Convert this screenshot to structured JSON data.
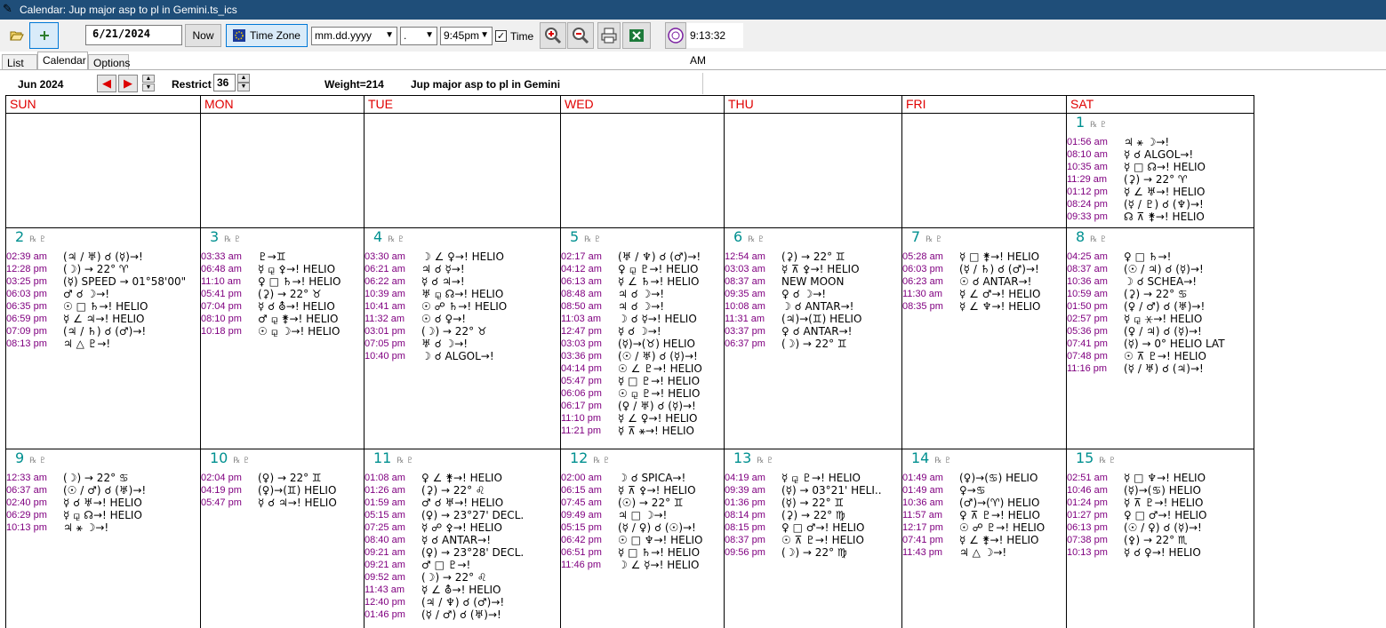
{
  "window": {
    "title": "Calendar: Jup major asp to pl in Gemini.ts_ics"
  },
  "toolbar": {
    "open_icon": "folder-open-icon",
    "add_icon": "plus-icon",
    "date_value": "6/21/2024",
    "now_label": "Now",
    "timezone_label": "Time Zone",
    "date_format_value": "mm.dd.yyyy",
    "separator_value": ".",
    "time_value": "9:45pm",
    "time_checked": true,
    "time_label": "Time",
    "clock_text": "9:13:32 AM"
  },
  "tabs": [
    "List",
    "Calendar",
    "Options"
  ],
  "nav": {
    "month_label": "Jun  2024",
    "restrict_label": "Restrict",
    "restrict_value": "36",
    "weight_text": "Weight=214",
    "search_name": "Jup major asp to pl in Gemini"
  },
  "calendar": {
    "day_names": [
      "SUN",
      "MON",
      "TUE",
      "WED",
      "THU",
      "FRI",
      "SAT"
    ],
    "weeks": [
      [
        {
          "date": "",
          "events": []
        },
        {
          "date": "",
          "events": []
        },
        {
          "date": "",
          "events": []
        },
        {
          "date": "",
          "events": []
        },
        {
          "date": "",
          "events": []
        },
        {
          "date": "",
          "events": []
        },
        {
          "date": "1",
          "events": [
            {
              "time": "01:56 am",
              "desc": "♃ ⚹ ☽→!"
            },
            {
              "time": "08:10 am",
              "desc": "☿ ☌ ALGOL→!"
            },
            {
              "time": "10:35 am",
              "desc": "☿ □ ☊→! HELIO"
            },
            {
              "time": "11:29 am",
              "desc": "(⚳) → 22° ♈"
            },
            {
              "time": "01:12 pm",
              "desc": "☿ ∠ ♅→! HELIO"
            },
            {
              "time": "08:24 pm",
              "desc": "(☿ / ♇) ☌ (♆)→!"
            },
            {
              "time": "09:33 pm",
              "desc": "☊ ⊼ ⚵→! HELIO"
            }
          ]
        }
      ],
      [
        {
          "date": "2",
          "events": [
            {
              "time": "02:39 am",
              "desc": "(♃ / ♅) ☌ (☿)→!"
            },
            {
              "time": "12:28 pm",
              "desc": "(☽) → 22° ♈"
            },
            {
              "time": "03:25 pm",
              "desc": "(☿) SPEED → 01°58'00\""
            },
            {
              "time": "06:03 pm",
              "desc": "♂ ☌ ☽→!"
            },
            {
              "time": "06:35 pm",
              "desc": "☉ □ ♄→! HELIO"
            },
            {
              "time": "06:59 pm",
              "desc": "☿ ∠ ♃→! HELIO"
            },
            {
              "time": "07:09 pm",
              "desc": "(♃ / ♄) ☌ (♂)→!"
            },
            {
              "time": "08:13 pm",
              "desc": "♃ △ ♇→!"
            }
          ]
        },
        {
          "date": "3",
          "events": [
            {
              "time": "03:33 am",
              "desc": "♇→♊"
            },
            {
              "time": "06:48 am",
              "desc": "☿ ⚼ ⚴→! HELIO"
            },
            {
              "time": "11:10 am",
              "desc": "♀ □ ♄→! HELIO"
            },
            {
              "time": "05:41 pm",
              "desc": "(⚳) → 22° ♉"
            },
            {
              "time": "07:04 pm",
              "desc": "☿ ☌ ⛢→! HELIO"
            },
            {
              "time": "08:10 pm",
              "desc": "♂ ⚼ ⚵→! HELIO"
            },
            {
              "time": "10:18 pm",
              "desc": "☉ ⚼ ☽→! HELIO"
            }
          ]
        },
        {
          "date": "4",
          "events": [
            {
              "time": "03:30 am",
              "desc": "☽ ∠ ♀→! HELIO"
            },
            {
              "time": "06:21 am",
              "desc": "♃ ☌ ☿→!"
            },
            {
              "time": "06:22 am",
              "desc": "☿ ☌ ♃→!"
            },
            {
              "time": "10:39 am",
              "desc": "♅ ⚼ ☊→! HELIO"
            },
            {
              "time": "10:41 am",
              "desc": "☉ ☍ ♄→! HELIO"
            },
            {
              "time": "11:32 am",
              "desc": "☉ ☌ ♀→!"
            },
            {
              "time": "03:01 pm",
              "desc": "(☽) → 22° ♉"
            },
            {
              "time": "07:05 pm",
              "desc": "♅ ☌ ☽→!"
            },
            {
              "time": "10:40 pm",
              "desc": "☽ ☌ ALGOL→!"
            }
          ]
        },
        {
          "date": "5",
          "events": [
            {
              "time": "02:17 am",
              "desc": "(♅ / ♆) ☌ (♂)→!"
            },
            {
              "time": "04:12 am",
              "desc": "♀ ⚼ ♇→! HELIO"
            },
            {
              "time": "06:13 am",
              "desc": "☿ ∠ ♄→! HELIO"
            },
            {
              "time": "08:48 am",
              "desc": "♃ ☌ ☽→!"
            },
            {
              "time": "08:50 am",
              "desc": "♃ ☌ ☽→!"
            },
            {
              "time": "11:03 am",
              "desc": "☽ ☌ ☿→! HELIO"
            },
            {
              "time": "12:47 pm",
              "desc": "☿ ☌ ☽→!"
            },
            {
              "time": "03:03 pm",
              "desc": "(☿)→(♉) HELIO"
            },
            {
              "time": "03:36 pm",
              "desc": "(☉ / ♅) ☌ (☿)→!"
            },
            {
              "time": "04:14 pm",
              "desc": "☉ ∠ ♇→! HELIO"
            },
            {
              "time": "05:47 pm",
              "desc": "☿ □ ♇→! HELIO"
            },
            {
              "time": "06:06 pm",
              "desc": "☉ ⚼ ♇→! HELIO"
            },
            {
              "time": "06:17 pm",
              "desc": "(♀ / ♅) ☌ (☿)→!"
            },
            {
              "time": "11:10 pm",
              "desc": "☿ ∠ ♀→! HELIO"
            },
            {
              "time": "11:21 pm",
              "desc": "☿ ⊼ ⚹→! HELIO"
            }
          ]
        },
        {
          "date": "6",
          "events": [
            {
              "time": "12:54 am",
              "desc": "(⚳) → 22° ♊"
            },
            {
              "time": "03:03 am",
              "desc": "☿ ⊼ ⚴→! HELIO"
            },
            {
              "time": "08:37 am",
              "desc": "NEW MOON"
            },
            {
              "time": "09:35 am",
              "desc": "♀ ☌ ☽→!"
            },
            {
              "time": "10:08 am",
              "desc": "☽ ☌ ANTAR→!"
            },
            {
              "time": "11:31 am",
              "desc": "(♃)→(♊) HELIO"
            },
            {
              "time": "03:37 pm",
              "desc": "♀ ☌ ANTAR→!"
            },
            {
              "time": "06:37 pm",
              "desc": "(☽) → 22° ♊"
            }
          ]
        },
        {
          "date": "7",
          "events": [
            {
              "time": "05:28 am",
              "desc": "☿ □ ⚵→! HELIO"
            },
            {
              "time": "06:03 pm",
              "desc": "(☿ / ♄) ☌ (♂)→!"
            },
            {
              "time": "06:23 am",
              "desc": "☉ ☌ ANTAR→!"
            },
            {
              "time": "11:30 am",
              "desc": "☿ ∠ ♂→! HELIO"
            },
            {
              "time": "08:35 pm",
              "desc": "☿ ∠ ♆→! HELIO"
            }
          ]
        },
        {
          "date": "8",
          "events": [
            {
              "time": "04:25 am",
              "desc": "♀ □ ♄→!"
            },
            {
              "time": "08:37 am",
              "desc": "(☉ / ♃) ☌ (☿)→!"
            },
            {
              "time": "10:36 am",
              "desc": "☽ ☌ SCHEA→!"
            },
            {
              "time": "10:59 am",
              "desc": "(⚳) → 22° ♋"
            },
            {
              "time": "01:50 pm",
              "desc": "(♀ / ♂) ☌ (♅)→!"
            },
            {
              "time": "02:57 pm",
              "desc": "☿ ⚼ ⚹→! HELIO"
            },
            {
              "time": "05:36 pm",
              "desc": "(♀ / ♃) ☌ (☿)→!"
            },
            {
              "time": "07:41 pm",
              "desc": "(☿) → 0°  HELIO LAT"
            },
            {
              "time": "07:48 pm",
              "desc": "☉ ⊼ ♇→! HELIO"
            },
            {
              "time": "11:16 pm",
              "desc": "(☿ / ♅) ☌ (♃)→!"
            }
          ]
        }
      ],
      [
        {
          "date": "9",
          "events": [
            {
              "time": "12:33 am",
              "desc": "(☽) → 22° ♋"
            },
            {
              "time": "06:37 am",
              "desc": "(☉ / ♂) ☌ (♅)→!"
            },
            {
              "time": "02:40 pm",
              "desc": "☿ ☌ ♅→! HELIO"
            },
            {
              "time": "06:29 pm",
              "desc": "☿ ⚼ ☊→! HELIO"
            },
            {
              "time": "10:13 pm",
              "desc": "♃ ⚹ ☽→!"
            }
          ]
        },
        {
          "date": "10",
          "events": [
            {
              "time": "02:04 pm",
              "desc": "(♀) → 22° ♊"
            },
            {
              "time": "04:19 pm",
              "desc": "(♀)→(♊) HELIO"
            },
            {
              "time": "05:47 pm",
              "desc": "☿ ☌ ♃→! HELIO"
            }
          ]
        },
        {
          "date": "11",
          "events": [
            {
              "time": "01:08 am",
              "desc": "♀ ∠ ⚵→! HELIO"
            },
            {
              "time": "01:26 am",
              "desc": "(⚳) → 22° ♌"
            },
            {
              "time": "01:59 am",
              "desc": "♂ ☌ ♅→! HELIO"
            },
            {
              "time": "05:15 am",
              "desc": "(♀) → 23°27'  DECL."
            },
            {
              "time": "07:25 am",
              "desc": "☿ ☍ ⚴→! HELIO"
            },
            {
              "time": "08:40 am",
              "desc": "☿ ☌ ANTAR→!"
            },
            {
              "time": "09:21 am",
              "desc": "(♀) → 23°28'  DECL."
            },
            {
              "time": "09:21 am",
              "desc": "♂ □ ♇→!"
            },
            {
              "time": "09:52 am",
              "desc": "(☽) → 22° ♌"
            },
            {
              "time": "11:43 am",
              "desc": "☿ ∠ ⛢→! HELIO"
            },
            {
              "time": "12:40 pm",
              "desc": "(♃ / ♆) ☌ (♂)→!"
            },
            {
              "time": "01:46 pm",
              "desc": "(☿ / ♂) ☌ (♅)→!"
            }
          ]
        },
        {
          "date": "12",
          "events": [
            {
              "time": "02:00 am",
              "desc": "☽ ☌ SPICA→!"
            },
            {
              "time": "06:15 am",
              "desc": "☿ ⊼ ⚴→! HELIO"
            },
            {
              "time": "07:45 am",
              "desc": "(☉) → 22° ♊"
            },
            {
              "time": "09:49 am",
              "desc": "♃ □ ☽→!"
            },
            {
              "time": "05:15 pm",
              "desc": "(☿ / ♀) ☌ (☉)→!"
            },
            {
              "time": "06:42 pm",
              "desc": "☉ □ ♆→! HELIO"
            },
            {
              "time": "06:51 pm",
              "desc": "☿ □ ♄→! HELIO"
            },
            {
              "time": "11:46 pm",
              "desc": "☽ ∠ ☿→! HELIO"
            }
          ]
        },
        {
          "date": "13",
          "events": [
            {
              "time": "04:19 am",
              "desc": "☿ ⚼ ♇→! HELIO"
            },
            {
              "time": "09:39 am",
              "desc": "(☿) → 03°21'  HELI.."
            },
            {
              "time": "01:36 pm",
              "desc": "(☿) → 22° ♊"
            },
            {
              "time": "08:14 pm",
              "desc": "(⚳) → 22° ♍"
            },
            {
              "time": "08:15 pm",
              "desc": "♀ □ ♂→! HELIO"
            },
            {
              "time": "08:37 pm",
              "desc": "☉ ⊼ ♇→! HELIO"
            },
            {
              "time": "09:56 pm",
              "desc": "(☽) → 22° ♍"
            }
          ]
        },
        {
          "date": "14",
          "events": [
            {
              "time": "01:49 am",
              "desc": "(♀)→(♋) HELIO"
            },
            {
              "time": "01:49 am",
              "desc": "♀→♋"
            },
            {
              "time": "10:36 am",
              "desc": "(♂)→(♈) HELIO"
            },
            {
              "time": "11:57 am",
              "desc": "♀ ⊼ ♇→! HELIO"
            },
            {
              "time": "12:17 pm",
              "desc": "☉ ☍ ♇→! HELIO"
            },
            {
              "time": "07:41 pm",
              "desc": "☿ ∠ ⚵→! HELIO"
            },
            {
              "time": "11:43 pm",
              "desc": "♃ △ ☽→!"
            }
          ]
        },
        {
          "date": "15",
          "events": [
            {
              "time": "02:51 am",
              "desc": "☿ □ ♆→! HELIO"
            },
            {
              "time": "10:46 am",
              "desc": "(☿)→(♋) HELIO"
            },
            {
              "time": "01:24 pm",
              "desc": "☿ ⊼ ♇→! HELIO"
            },
            {
              "time": "01:27 pm",
              "desc": "♀ □ ♂→! HELIO"
            },
            {
              "time": "06:13 pm",
              "desc": "(☉ / ♀) ☌ (☿)→!"
            },
            {
              "time": "07:38 pm",
              "desc": "(⚴) → 22° ♏"
            },
            {
              "time": "10:13 pm",
              "desc": "☿ ☌ ♀→! HELIO"
            }
          ]
        }
      ]
    ]
  }
}
